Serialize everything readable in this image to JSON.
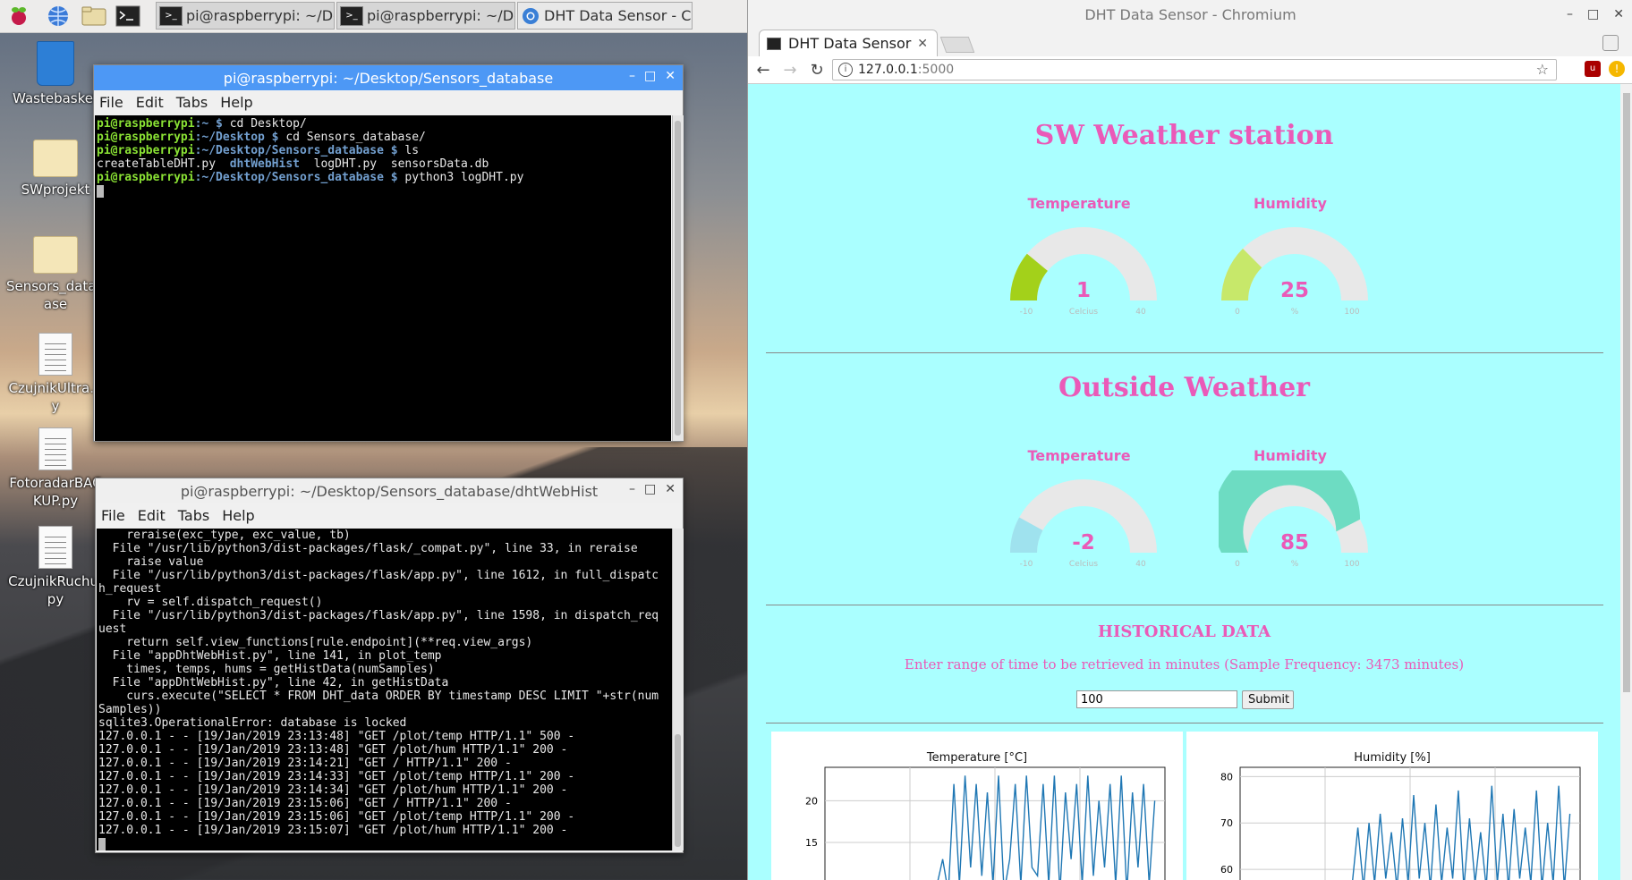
{
  "taskbar": {
    "tasks": [
      {
        "label": "pi@raspberrypi: ~/De..."
      },
      {
        "label": "pi@raspberrypi: ~/De..."
      },
      {
        "label": "DHT Data Sensor - C..."
      }
    ]
  },
  "desktop": {
    "icons": [
      {
        "label": "Wastebasket"
      },
      {
        "label": "SWprojekt"
      },
      {
        "label": "Sensors_database"
      },
      {
        "label": "CzujnikUltra.py"
      },
      {
        "label": "FotoradarBACKUP.py"
      },
      {
        "label": "CzujnikRuchu.py"
      }
    ]
  },
  "term1": {
    "title": "pi@raspberrypi: ~/Desktop/Sensors_database",
    "menu": [
      "File",
      "Edit",
      "Tabs",
      "Help"
    ],
    "lines": [
      {
        "user": "pi@raspberrypi",
        "path": ":~ $",
        "cmd": " cd Desktop/"
      },
      {
        "user": "pi@raspberrypi",
        "path": ":~/Desktop $",
        "cmd": " cd Sensors_database/"
      },
      {
        "user": "pi@raspberrypi",
        "path": ":~/Desktop/Sensors_database $",
        "cmd": " ls"
      },
      {
        "plain": "createTableDHT.py  ",
        "dir": "dhtWebHist",
        "plain2": "  logDHT.py  sensorsData.db"
      },
      {
        "user": "pi@raspberrypi",
        "path": ":~/Desktop/Sensors_database $",
        "cmd": " python3 logDHT.py"
      }
    ]
  },
  "term2": {
    "title": "pi@raspberrypi: ~/Desktop/Sensors_database/dhtWebHist",
    "menu": [
      "File",
      "Edit",
      "Tabs",
      "Help"
    ],
    "output": "    reraise(exc_type, exc_value, tb)\n  File \"/usr/lib/python3/dist-packages/flask/_compat.py\", line 33, in reraise\n    raise value\n  File \"/usr/lib/python3/dist-packages/flask/app.py\", line 1612, in full_dispatc\nh_request\n    rv = self.dispatch_request()\n  File \"/usr/lib/python3/dist-packages/flask/app.py\", line 1598, in dispatch_req\nuest\n    return self.view_functions[rule.endpoint](**req.view_args)\n  File \"appDhtWebHist.py\", line 141, in plot_temp\n    times, temps, hums = getHistData(numSamples)\n  File \"appDhtWebHist.py\", line 42, in getHistData\n    curs.execute(\"SELECT * FROM DHT_data ORDER BY timestamp DESC LIMIT \"+str(num\nSamples))\nsqlite3.OperationalError: database is locked\n127.0.0.1 - - [19/Jan/2019 23:13:48] \"GET /plot/temp HTTP/1.1\" 500 -\n127.0.0.1 - - [19/Jan/2019 23:13:48] \"GET /plot/hum HTTP/1.1\" 200 -\n127.0.0.1 - - [19/Jan/2019 23:14:21] \"GET / HTTP/1.1\" 200 -\n127.0.0.1 - - [19/Jan/2019 23:14:33] \"GET /plot/temp HTTP/1.1\" 200 -\n127.0.0.1 - - [19/Jan/2019 23:14:34] \"GET /plot/hum HTTP/1.1\" 200 -\n127.0.0.1 - - [19/Jan/2019 23:15:06] \"GET / HTTP/1.1\" 200 -\n127.0.0.1 - - [19/Jan/2019 23:15:06] \"GET /plot/temp HTTP/1.1\" 200 -\n127.0.0.1 - - [19/Jan/2019 23:15:07] \"GET /plot/hum HTTP/1.1\" 200 -"
  },
  "browser": {
    "window_title": "DHT Data Sensor - Chromium",
    "tab_title": "DHT Data Sensor",
    "url_host": "127.0.0.1",
    "url_port": ":5000",
    "page": {
      "station_title": "SW Weather station",
      "outside_title": "Outside Weather",
      "gauges": [
        {
          "label": "Temperature",
          "value": "1",
          "unit": "Celcius",
          "min": "-10",
          "max": "40",
          "fraction": 0.22,
          "color": "#a3d11a"
        },
        {
          "label": "Humidity",
          "value": "25",
          "unit": "%",
          "min": "0",
          "max": "100",
          "fraction": 0.25,
          "color": "#c7e86a"
        },
        {
          "label": "Temperature",
          "value": "-2",
          "unit": "Celcius",
          "min": "-10",
          "max": "40",
          "fraction": 0.16,
          "color": "#9fe2ee"
        },
        {
          "label": "Humidity",
          "value": "85",
          "unit": "%",
          "min": "0",
          "max": "100",
          "fraction": 0.85,
          "color": "#6ddcc2"
        }
      ],
      "hist_title": "HISTORICAL DATA",
      "hist_desc": "Enter range of time to be retrieved in minutes (Sample Frequency: 3473 minutes)",
      "input_value": "100",
      "submit_label": "Submit",
      "chart_titles": [
        "Temperature [°C]",
        "Humidity [%]"
      ]
    }
  },
  "chart_data": [
    {
      "type": "line",
      "title": "Temperature [°C]",
      "yticks": [
        "20",
        "15"
      ],
      "ylim": [
        9,
        24
      ],
      "values": [
        10,
        13,
        9,
        22,
        10,
        23,
        12,
        22,
        11,
        21,
        10,
        23,
        9,
        13,
        22,
        10,
        23,
        12,
        11,
        22,
        10,
        23,
        9,
        21,
        13,
        22,
        10,
        23,
        11,
        20,
        12,
        22,
        10,
        23,
        9,
        21,
        12,
        22,
        10,
        20
      ]
    },
    {
      "type": "line",
      "title": "Humidity [%]",
      "yticks": [
        "80",
        "70",
        "60"
      ],
      "ylim": [
        55,
        82
      ],
      "values": [
        57,
        69,
        56,
        70,
        57,
        72,
        58,
        68,
        56,
        71,
        57,
        76,
        58,
        70,
        56,
        74,
        57,
        69,
        58,
        77,
        56,
        71,
        57,
        68,
        56,
        78,
        57,
        72,
        56,
        73,
        58,
        69,
        57,
        77,
        56,
        70,
        57,
        78,
        56,
        72
      ]
    }
  ]
}
